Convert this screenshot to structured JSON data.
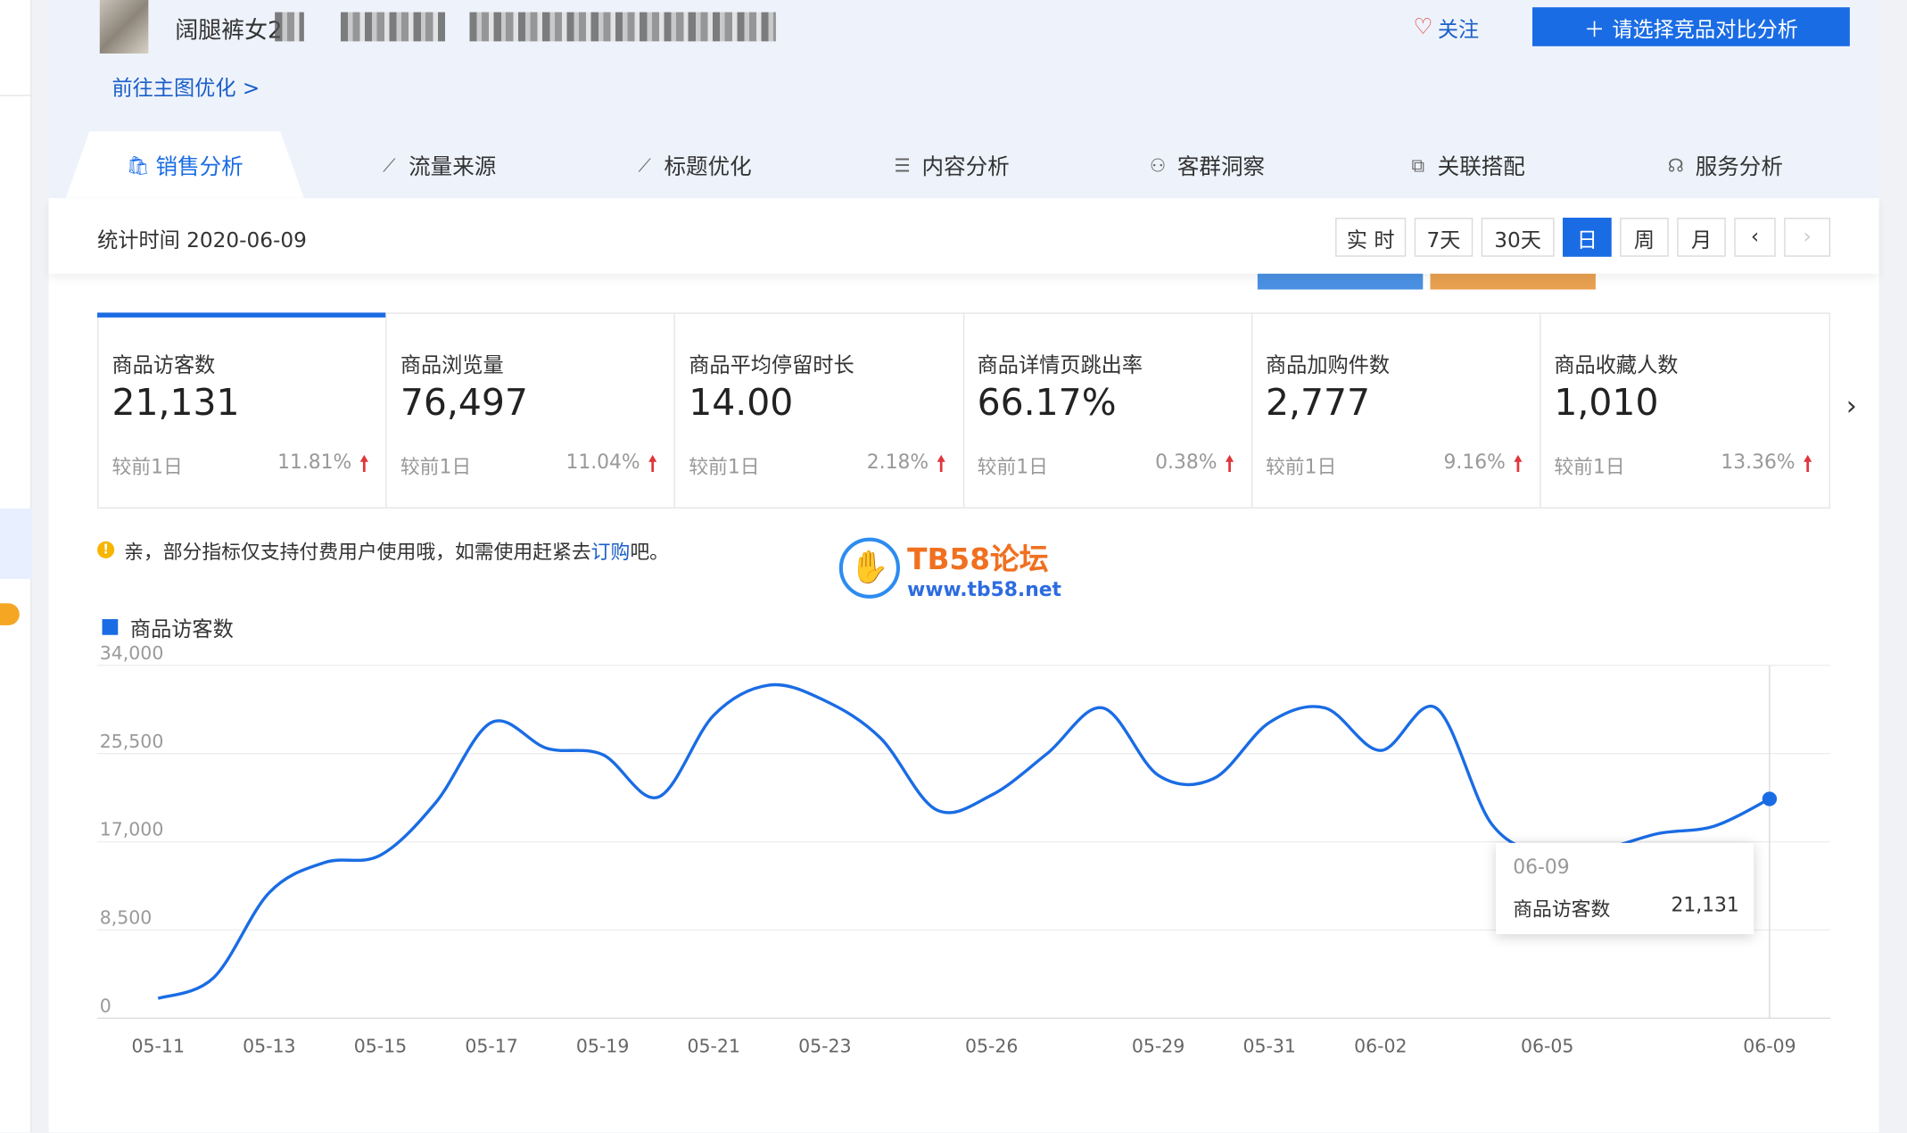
{
  "product": {
    "title": "阔腿裤女2"
  },
  "header": {
    "follow_label": "关注",
    "compare_label": "请选择竞品对比分析",
    "goto_label": "前往主图优化 >"
  },
  "tabs": [
    {
      "label": "销售分析",
      "icon": "bag-icon"
    },
    {
      "label": "流量来源",
      "icon": "line-chart-icon"
    },
    {
      "label": "标题优化",
      "icon": "line-chart-icon"
    },
    {
      "label": "内容分析",
      "icon": "document-icon"
    },
    {
      "label": "客群洞察",
      "icon": "users-icon"
    },
    {
      "label": "关联搭配",
      "icon": "link-icon"
    },
    {
      "label": "服务分析",
      "icon": "headset-icon"
    }
  ],
  "datebar": {
    "stat_time": "统计时间 2020-06-09",
    "buttons": [
      "实 时",
      "7天",
      "30天",
      "日",
      "周",
      "月"
    ],
    "active": "日"
  },
  "metrics": [
    {
      "label": "商品访客数",
      "value": "21,131",
      "cmp": "较前1日",
      "pct": "11.81%"
    },
    {
      "label": "商品浏览量",
      "value": "76,497",
      "cmp": "较前1日",
      "pct": "11.04%"
    },
    {
      "label": "商品平均停留时长",
      "value": "14.00",
      "cmp": "较前1日",
      "pct": "2.18%"
    },
    {
      "label": "商品详情页跳出率",
      "value": "66.17%",
      "cmp": "较前1日",
      "pct": "0.38%"
    },
    {
      "label": "商品加购件数",
      "value": "2,777",
      "cmp": "较前1日",
      "pct": "9.16%"
    },
    {
      "label": "商品收藏人数",
      "value": "1,010",
      "cmp": "较前1日",
      "pct": "13.36%"
    }
  ],
  "notice": {
    "pre": "亲，部分指标仅支持付费用户使用哦，如需使用赶紧去",
    "link": "订购",
    "post": "吧。"
  },
  "watermark": {
    "title": "TB58论坛",
    "url": "www.tb58.net"
  },
  "tooltip": {
    "date": "06-09",
    "name": "商品访客数",
    "value": "21,131"
  },
  "colors": {
    "accent": "#1a6ce4",
    "up": "#e0353b"
  },
  "chart_data": {
    "type": "line",
    "series": [
      {
        "name": "商品访客数"
      }
    ],
    "ylim": [
      0,
      34000
    ],
    "yticks": [
      0,
      8500,
      17000,
      25500,
      34000
    ],
    "ytick_labels": [
      "0",
      "8,500",
      "17,000",
      "25,500",
      "34,000"
    ],
    "xtick_labels": [
      "05-11",
      "05-13",
      "05-15",
      "05-17",
      "05-19",
      "05-21",
      "05-23",
      "05-26",
      "05-29",
      "05-31",
      "06-02",
      "06-05",
      "06-09"
    ],
    "x": [
      "05-11",
      "05-12",
      "05-13",
      "05-14",
      "05-15",
      "05-16",
      "05-17",
      "05-18",
      "05-19",
      "05-20",
      "05-21",
      "05-22",
      "05-23",
      "05-24",
      "05-25",
      "05-26",
      "05-27",
      "05-28",
      "05-29",
      "05-30",
      "05-31",
      "06-01",
      "06-02",
      "06-03",
      "06-04",
      "06-05",
      "06-06",
      "06-07",
      "06-08",
      "06-09"
    ],
    "values": [
      1900,
      3900,
      12100,
      15000,
      15700,
      20800,
      28500,
      26000,
      25400,
      21300,
      29200,
      32100,
      30600,
      27000,
      20100,
      21500,
      25500,
      29900,
      23400,
      23100,
      28500,
      29900,
      25800,
      29900,
      18700,
      15900,
      16300,
      17800,
      18500,
      21131
    ]
  }
}
